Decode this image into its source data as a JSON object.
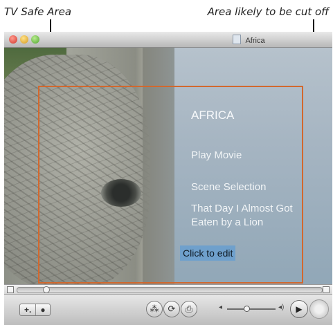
{
  "annotations": {
    "left_label": "TV Safe Area",
    "right_label": "Area likely to be cut off"
  },
  "window": {
    "title": "Africa",
    "title_icon": "document-icon"
  },
  "dvd_menu": {
    "title": "AFRICA",
    "items": [
      "Play Movie",
      "Scene Selection",
      "That Day I Almost Got Eaten by a Lion"
    ],
    "edit_button": "Click to edit"
  },
  "toolbar": {
    "add_label": "+.",
    "info_label": "●",
    "buttons": [
      "angle-icon",
      "loop-icon",
      "title-menu-icon",
      "play-icon",
      "remote-icon"
    ]
  },
  "colors": {
    "safe_area_border": "#d2682e",
    "edit_highlight": "#6fa0cc",
    "menu_text": "#f2f5f7"
  }
}
